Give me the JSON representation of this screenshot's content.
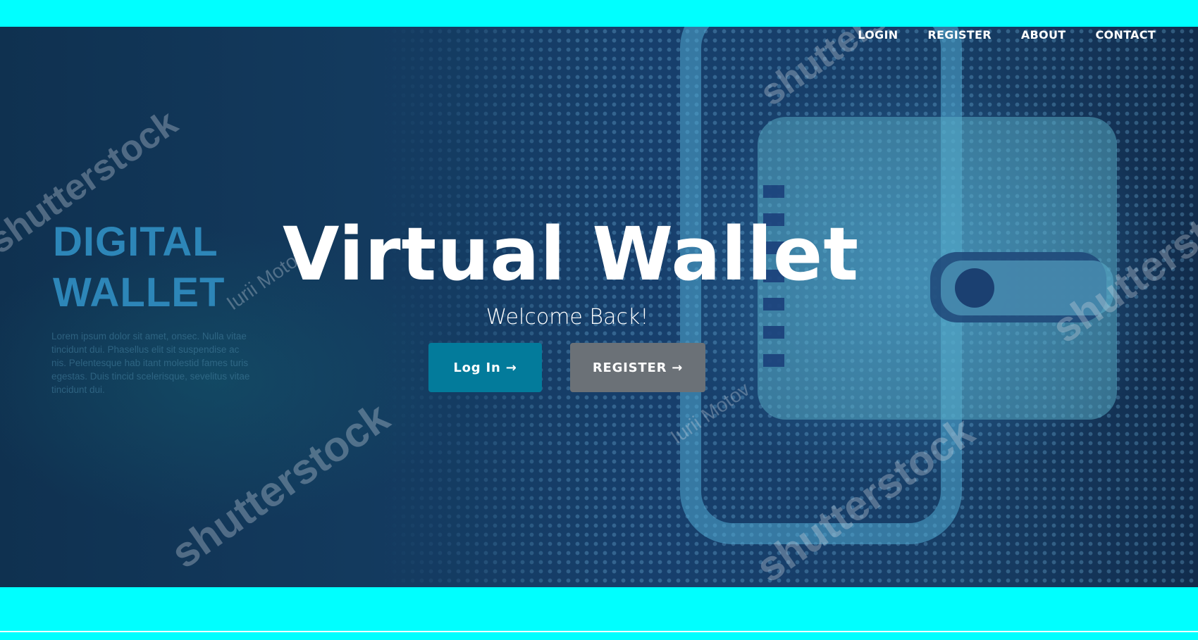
{
  "nav": {
    "items": [
      {
        "label": "LOGIN"
      },
      {
        "label": "REGISTER"
      },
      {
        "label": "ABOUT"
      },
      {
        "label": "CONTACT"
      }
    ]
  },
  "hero": {
    "title": "Virtual Wallet",
    "subtitle": "Welcome Back!",
    "login_button": "Log In →",
    "register_button": "REGISTER →"
  },
  "background": {
    "heading_line1": "DIGITAL",
    "heading_line2": "WALLET",
    "lorem": "Lorem ipsum dolor sit amet, onsec. Nulla vitae tincidunt dui. Phasellus elit sit suspendise ac nis. Pelentesque hab itant molestid fames turis egestas. Duis tincid scelerisque, sevelitus vitae tincidunt dui.",
    "watermark_brand": "shutterstock",
    "watermark_author": "Iurii Motov"
  },
  "colors": {
    "page_background": "#00ffff",
    "login_button": "#037b9b",
    "register_button": "#6b7177",
    "text": "#ffffff"
  }
}
